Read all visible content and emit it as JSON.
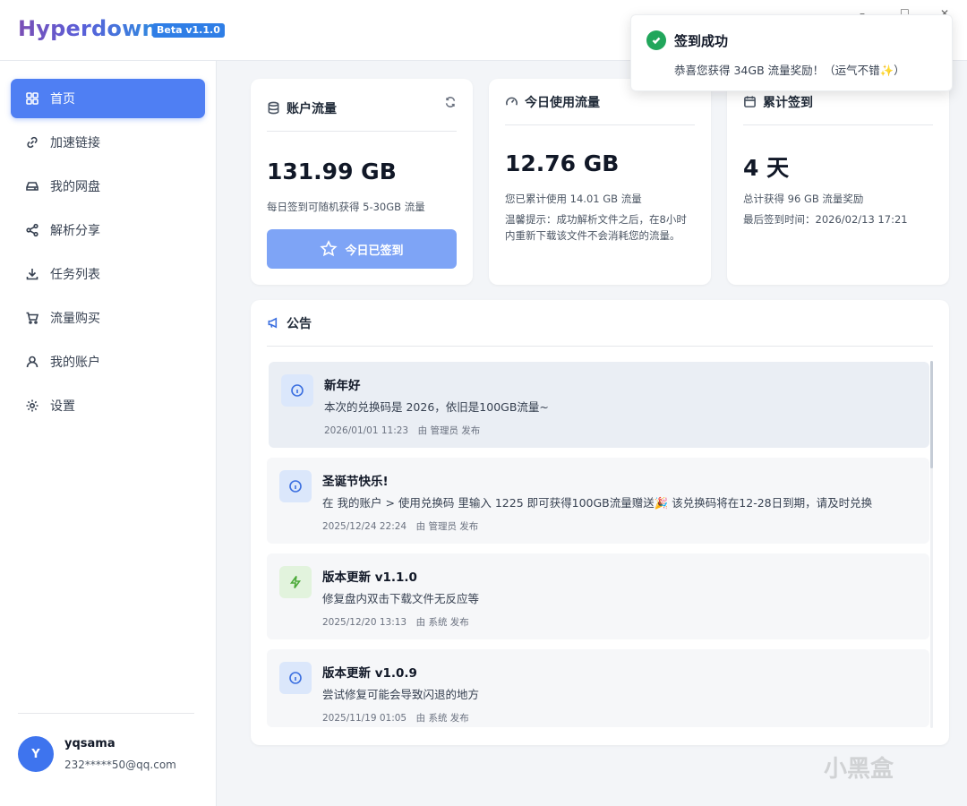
{
  "app": {
    "logo": "Hyperdown",
    "badge": "Beta v1.1.0"
  },
  "window_controls": {
    "minimize": "–",
    "maximize": "☐",
    "close": "✕"
  },
  "sidebar": {
    "items": [
      {
        "label": "首页",
        "icon": "grid-icon"
      },
      {
        "label": "加速链接",
        "icon": "link-icon"
      },
      {
        "label": "我的网盘",
        "icon": "drive-icon"
      },
      {
        "label": "解析分享",
        "icon": "share-icon"
      },
      {
        "label": "任务列表",
        "icon": "download-icon"
      },
      {
        "label": "流量购买",
        "icon": "cart-icon"
      },
      {
        "label": "我的账户",
        "icon": "user-icon"
      },
      {
        "label": "设置",
        "icon": "gear-icon"
      }
    ],
    "user": {
      "initial": "Y",
      "name": "yqsama",
      "email": "232*****50@qq.com"
    }
  },
  "cards": {
    "account": {
      "title": "账户流量",
      "value": "131.99 GB",
      "note": "每日签到可随机获得 5-30GB 流量",
      "button": "今日已签到"
    },
    "today": {
      "title": "今日使用流量",
      "value": "12.76 GB",
      "note1": "您已累计使用 14.01 GB 流量",
      "note2": "温馨提示：成功解析文件之后，在8小时",
      "note3": "内重新下载该文件不会消耗您的流量。"
    },
    "signin": {
      "title": "累计签到",
      "value": "4 天",
      "note1": "总计获得 96 GB 流量奖励",
      "note2": "最后签到时间：2026/02/13 17:21"
    }
  },
  "announcements": {
    "title": "公告",
    "items": [
      {
        "title": "新年好",
        "body": "本次的兑换码是 2026，依旧是100GB流量~",
        "meta": "2026/01/01 11:23　由 管理员 发布",
        "icon": "info-icon"
      },
      {
        "title": "圣诞节快乐!",
        "body": "在 我的账户 > 使用兑换码 里输入 1225 即可获得100GB流量赠送🎉 该兑换码将在12-28日到期，请及时兑换",
        "meta": "2025/12/24 22:24　由 管理员 发布",
        "icon": "info-icon"
      },
      {
        "title": "版本更新 v1.1.0",
        "body": "修复盘内双击下载文件无反应等",
        "meta": "2025/12/20 13:13　由 系统 发布",
        "icon": "bolt-icon"
      },
      {
        "title": "版本更新 v1.0.9",
        "body": "尝试修复可能会导致闪退的地方",
        "meta": "2025/11/19 01:05　由 系统 发布",
        "icon": "info-icon"
      }
    ]
  },
  "toast": {
    "title": "签到成功",
    "message": "恭喜您获得 34GB 流量奖励！（运气不错✨）"
  },
  "watermark": "小黑盒",
  "colors": {
    "accent": "#4f7ff3",
    "success": "#21a65b",
    "button_disabled": "#7ea4f6"
  }
}
